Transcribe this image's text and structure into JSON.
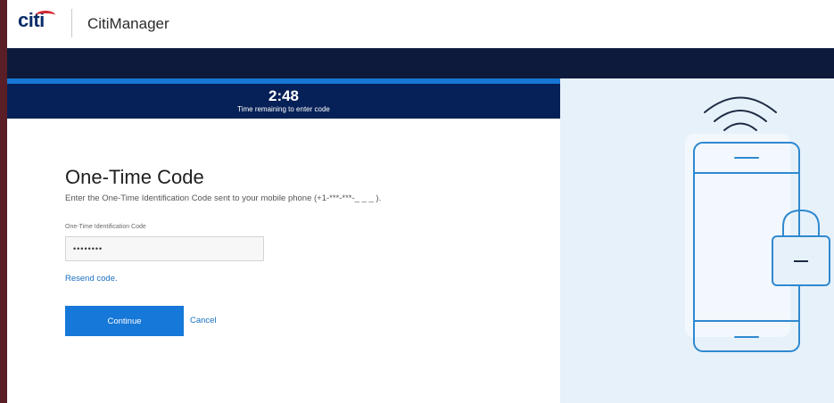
{
  "header": {
    "logo_text": "citi",
    "app_title": "CitiManager"
  },
  "timer": {
    "value": "2:48",
    "label": "Time remaining to enter code"
  },
  "form": {
    "title": "One-Time Code",
    "instructions": "Enter the One-Time Identification Code sent to your mobile phone (+1-***-***-_ _ _ ).",
    "field_label": "One-Time Identification Code",
    "field_value": "••••••••",
    "resend_label": "Resend code.",
    "continue_label": "Continue",
    "cancel_label": "Cancel"
  },
  "icons": {
    "brand_logo": "citi-logo",
    "illustration": "phone-lock-icon",
    "signal": "wifi-signal-icon",
    "lock": "padlock-icon"
  },
  "colors": {
    "brand_blue": "#062157",
    "accent_blue": "#1678d8",
    "link_blue": "#1a6fc0",
    "brand_red": "#d22630",
    "illustration_bg": "#e7f1fa"
  }
}
